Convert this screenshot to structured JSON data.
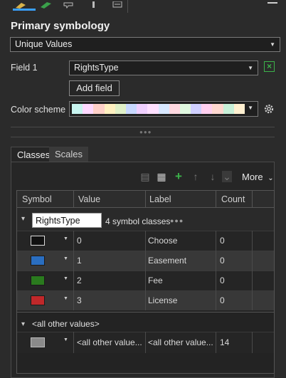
{
  "ribbon": {
    "icons": [
      "paintbrush-icon",
      "pencil-icon",
      "shapes-icon",
      "brush-icon",
      "list-icon"
    ],
    "minimize_icon": "minimize-icon"
  },
  "primary_symbology": {
    "title": "Primary symbology",
    "method": "Unique Values",
    "field1_label": "Field 1",
    "field1_value": "RightsType",
    "add_field": "Add field",
    "color_scheme_label": "Color scheme",
    "color_scheme_colors": [
      "#c8f5f0",
      "#ffd9ff",
      "#ffd0c8",
      "#fff0c0",
      "#e0f0c8",
      "#c8d8ff",
      "#f0d0ff",
      "#ffe0ff",
      "#d8e8ff",
      "#ffd8e0",
      "#e0f8e0",
      "#d0d0ff",
      "#ffd0f0",
      "#ffd8d0",
      "#c8f0d8",
      "#fff0d0"
    ]
  },
  "tabs": {
    "classes": "Classes",
    "scales": "Scales"
  },
  "toolbar": {
    "more": "More"
  },
  "table": {
    "columns": [
      "Symbol",
      "Value",
      "Label",
      "Count"
    ],
    "group": {
      "name": "RightsType",
      "summary": "4 symbol classes",
      "dots": "●●●"
    },
    "rows": [
      {
        "color": "#111111",
        "value": "0",
        "label": "Choose",
        "count": "0"
      },
      {
        "color": "#2a6ec0",
        "value": "1",
        "label": "Easement",
        "count": "0"
      },
      {
        "color": "#2a7a1e",
        "value": "2",
        "label": "Fee",
        "count": "0"
      },
      {
        "color": "#c0282a",
        "value": "3",
        "label": "License",
        "count": "0"
      }
    ],
    "other": {
      "header": "<all other values>",
      "color": "#8a8a8a",
      "value": "<all other value...",
      "label": "<all other value...",
      "count": "14"
    }
  }
}
